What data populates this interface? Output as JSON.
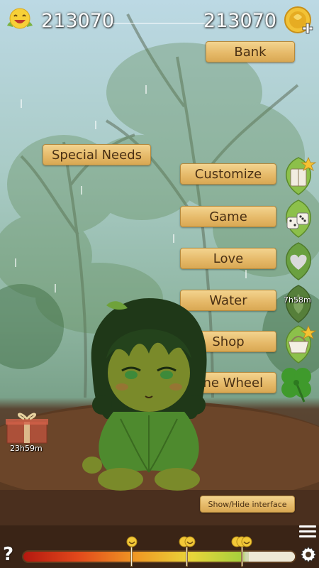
{
  "stats": {
    "happiness_value": "213070",
    "coins_value": "213070"
  },
  "menu": {
    "bank": "Bank",
    "special_needs": "Special Needs",
    "customize": "Customize",
    "game": "Game",
    "love": "Love",
    "water": "Water",
    "shop": "Shop",
    "fortune_wheel": "Fortune Wheel",
    "show_hide": "Show/Hide interface"
  },
  "timers": {
    "water": "7h58m",
    "gift": "23h59m"
  },
  "bottom": {
    "help": "?",
    "happiness_meter_level": 0.83
  },
  "icons": {
    "top_left": "happy-face-icon",
    "top_right": "coin-plus-icon",
    "customize": "wardrobe-leaf-icon",
    "game": "dice-leaf-icon",
    "love": "heart-leaf-icon",
    "water": "drop-leaf-icon",
    "shop": "basket-leaf-icon",
    "fortune": "clover-icon",
    "gift": "gift-box-icon",
    "settings": "gear-icon",
    "menu": "hamburger-menu-icon"
  },
  "colors": {
    "button": "#e6ba6a",
    "button_text": "#4a3014",
    "leaf": "#8cc04a"
  }
}
